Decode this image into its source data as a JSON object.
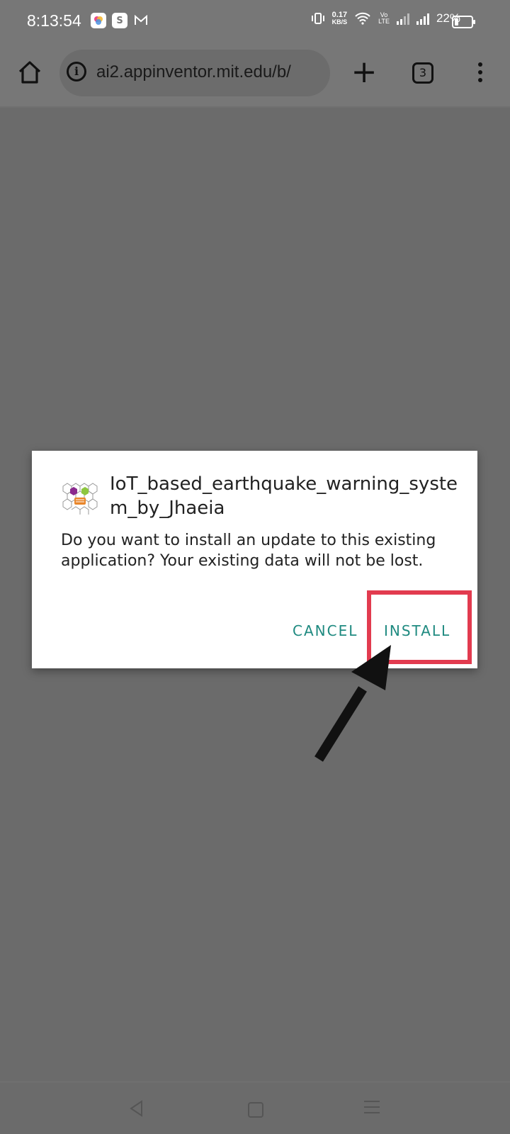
{
  "status_bar": {
    "time": "8:13:54",
    "net_speed_value": "0.17",
    "net_speed_unit": "KB/S",
    "volte_top": "Vo",
    "volte_bottom": "LTE",
    "battery_percent": "22%",
    "notification_icons": [
      "photos-icon",
      "shopee-icon",
      "gmail-icon"
    ]
  },
  "browser": {
    "url": "ai2.appinventor.mit.edu/b/",
    "tab_count": "3"
  },
  "dialog": {
    "app_name": "IoT_based_earthquake_warning_system_by_Jhaeia",
    "message": "Do you want to install an update to this existing application? Your existing data will not be lost.",
    "cancel_label": "CANCEL",
    "install_label": "INSTALL",
    "button_color": "#1f8a80"
  },
  "annotation": {
    "highlight_color": "#e23b4f",
    "arrow_color": "#111111"
  }
}
